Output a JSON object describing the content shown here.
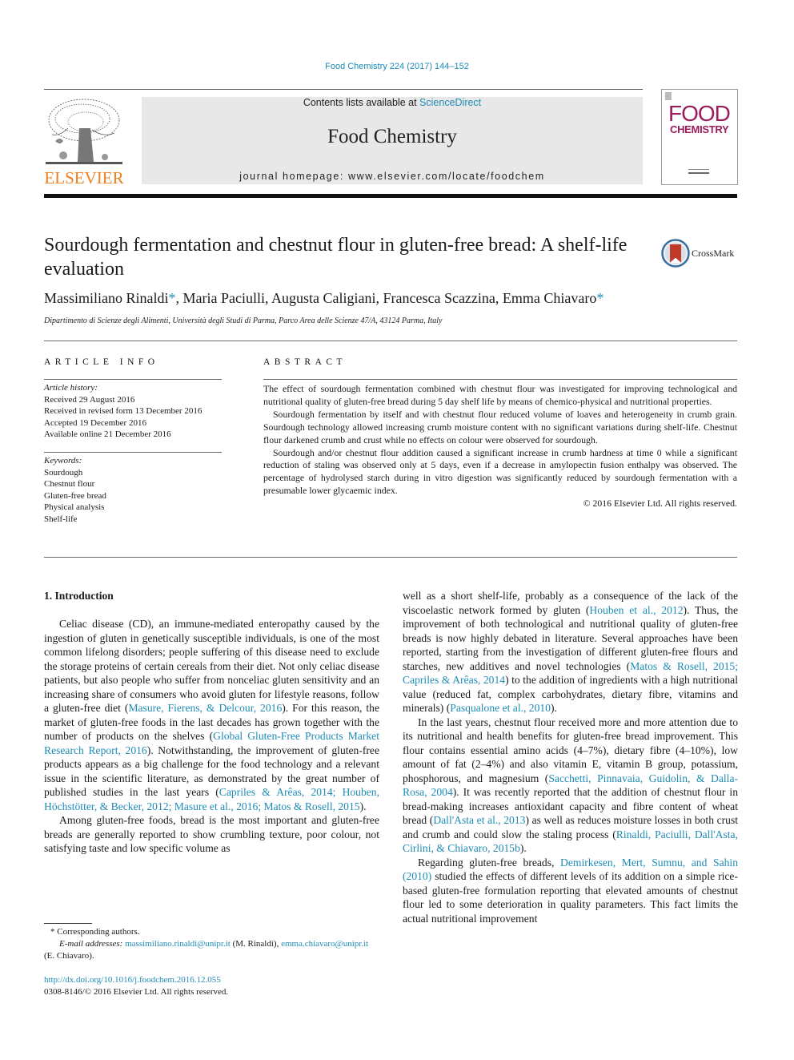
{
  "header": {
    "citation": "Food Chemistry 224 (2017) 144–152",
    "contents_prefix": "Contents lists available at ",
    "contents_link": "ScienceDirect",
    "journal_name": "Food Chemistry",
    "homepage": "journal homepage: www.elsevier.com/locate/foodchem",
    "publisher_logo_text": "ELSEVIER",
    "cover_word1": "FOOD",
    "cover_word2": "CHEMISTRY",
    "crossmark_label": "CrossMark"
  },
  "article": {
    "title": "Sourdough fermentation and chestnut flour in gluten-free bread: A shelf-life evaluation",
    "authors": [
      {
        "name": "Massimiliano Rinaldi",
        "corresponding": true
      },
      {
        "name": "Maria Paciulli",
        "corresponding": false
      },
      {
        "name": "Augusta Caligiani",
        "corresponding": false
      },
      {
        "name": "Francesca Scazzina",
        "corresponding": false
      },
      {
        "name": "Emma Chiavaro",
        "corresponding": true
      }
    ],
    "author_sep": ", ",
    "star": "*",
    "affiliation": "Dipartimento di Scienze degli Alimenti, Università degli Studi di Parma, Parco Area delle Scienze 47/A, 43124 Parma, Italy"
  },
  "article_info": {
    "heading": "ARTICLE INFO",
    "history_label": "Article history:",
    "history": [
      "Received 29 August 2016",
      "Received in revised form 13 December 2016",
      "Accepted 19 December 2016",
      "Available online 21 December 2016"
    ],
    "keywords_label": "Keywords:",
    "keywords": [
      "Sourdough",
      "Chestnut flour",
      "Gluten-free bread",
      "Physical analysis",
      "Shelf-life"
    ]
  },
  "abstract": {
    "heading": "ABSTRACT",
    "paragraphs": [
      "The effect of sourdough fermentation combined with chestnut flour was investigated for improving technological and nutritional quality of gluten-free bread during 5 day shelf life by means of chemico-physical and nutritional properties.",
      "Sourdough fermentation by itself and with chestnut flour reduced volume of loaves and heterogeneity in crumb grain. Sourdough technology allowed increasing crumb moisture content with no significant variations during shelf-life. Chestnut flour darkened crumb and crust while no effects on colour were observed for sourdough.",
      "Sourdough and/or chestnut flour addition caused a significant increase in crumb hardness at time 0 while a significant reduction of staling was observed only at 5 days, even if a decrease in amylopectin fusion enthalpy was observed. The percentage of hydrolysed starch during in vitro digestion was significantly reduced by sourdough fermentation with a presumable lower glycaemic index."
    ],
    "copyright": "© 2016 Elsevier Ltd. All rights reserved."
  },
  "introduction": {
    "heading": "1. Introduction",
    "left_col": [
      [
        {
          "t": "Celiac disease (CD), an immune-mediated enteropathy caused by the ingestion of gluten in genetically susceptible individuals, is one of the most common lifelong disorders; people suffering of this disease need to exclude the storage proteins of certain cereals from their diet. Not only celiac disease patients, but also people who suffer from nonceliac gluten sensitivity and an increasing share of consumers who avoid gluten for lifestyle reasons, follow a gluten-free diet ("
        },
        {
          "t": "Masure, Fierens, & Delcour, 2016",
          "link": true
        },
        {
          "t": "). For this reason, the market of gluten-free foods in the last decades has grown together with the number of products on the shelves ("
        },
        {
          "t": "Global Gluten-Free Products Market Research Report, 2016",
          "link": true
        },
        {
          "t": "). Notwithstanding, the improvement of gluten-free products appears as a big challenge for the food technology and a relevant issue in the scientific literature, as demonstrated by the great number of published studies in the last years ("
        },
        {
          "t": "Capriles & Arêas, 2014; Houben, Höchstötter, & Becker, 2012; Masure et al., 2016; Matos & Rosell, 2015",
          "link": true
        },
        {
          "t": ")."
        }
      ],
      [
        {
          "t": "Among gluten-free foods, bread is the most important and gluten-free breads are generally reported to show crumbling texture, poor colour, not satisfying taste and low specific volume as"
        }
      ]
    ],
    "right_col": [
      [
        {
          "t": "well as a short shelf-life, probably as a consequence of the lack of the viscoelastic network formed by gluten ("
        },
        {
          "t": "Houben et al., 2012",
          "link": true
        },
        {
          "t": "). Thus, the improvement of both technological and nutritional quality of gluten-free breads is now highly debated in literature. Several approaches have been reported, starting from the investigation of different gluten-free flours and starches, new additives and novel technologies ("
        },
        {
          "t": "Matos & Rosell, 2015; Capriles & Arêas, 2014",
          "link": true
        },
        {
          "t": ") to the addition of ingredients with a high nutritional value (reduced fat, complex carbohydrates, dietary fibre, vitamins and minerals) ("
        },
        {
          "t": "Pasqualone et al., 2010",
          "link": true
        },
        {
          "t": ")."
        }
      ],
      [
        {
          "t": "In the last years, chestnut flour received more and more attention due to its nutritional and health benefits for gluten-free bread improvement. This flour contains essential amino acids (4–7%), dietary fibre (4–10%), low amount of fat (2–4%) and also vitamin E, vitamin B group, potassium, phosphorous, and magnesium ("
        },
        {
          "t": "Sacchetti, Pinnavaia, Guidolin, & Dalla-Rosa, 2004",
          "link": true
        },
        {
          "t": "). It was recently reported that the addition of chestnut flour in bread-making increases antioxidant capacity and fibre content of wheat bread ("
        },
        {
          "t": "Dall'Asta et al., 2013",
          "link": true
        },
        {
          "t": ") as well as reduces moisture losses in both crust and crumb and could slow the staling process ("
        },
        {
          "t": "Rinaldi, Paciulli, Dall'Asta, Cirlini, & Chiavaro, 2015b",
          "link": true
        },
        {
          "t": ")."
        }
      ],
      [
        {
          "t": "Regarding gluten-free breads, "
        },
        {
          "t": "Demirkesen, Mert, Sumnu, and Sahin (2010)",
          "link": true
        },
        {
          "t": " studied the effects of different levels of its addition on a simple rice-based gluten-free formulation reporting that elevated amounts of chestnut flour led to some deterioration in quality parameters. This fact limits the actual nutritional improvement"
        }
      ]
    ]
  },
  "footnotes": {
    "corresponding_mark": "*",
    "corresponding_text": " Corresponding authors.",
    "email_label": "E-mail addresses: ",
    "email1": "massimiliano.rinaldi@unipr.it",
    "email1_owner": " (M. Rinaldi), ",
    "email2": "emma.chiavaro@unipr.it",
    "email2_owner": " (E. Chiavaro).",
    "doi": "http://dx.doi.org/10.1016/j.foodchem.2016.12.055",
    "issn": "0308-8146/© 2016 Elsevier Ltd. All rights reserved."
  },
  "colors": {
    "link": "#1f8bb5",
    "elsevier_orange": "#f07f1b",
    "cover_magenta": "#9a1d5b",
    "banner_gray": "#e8e8e8"
  }
}
